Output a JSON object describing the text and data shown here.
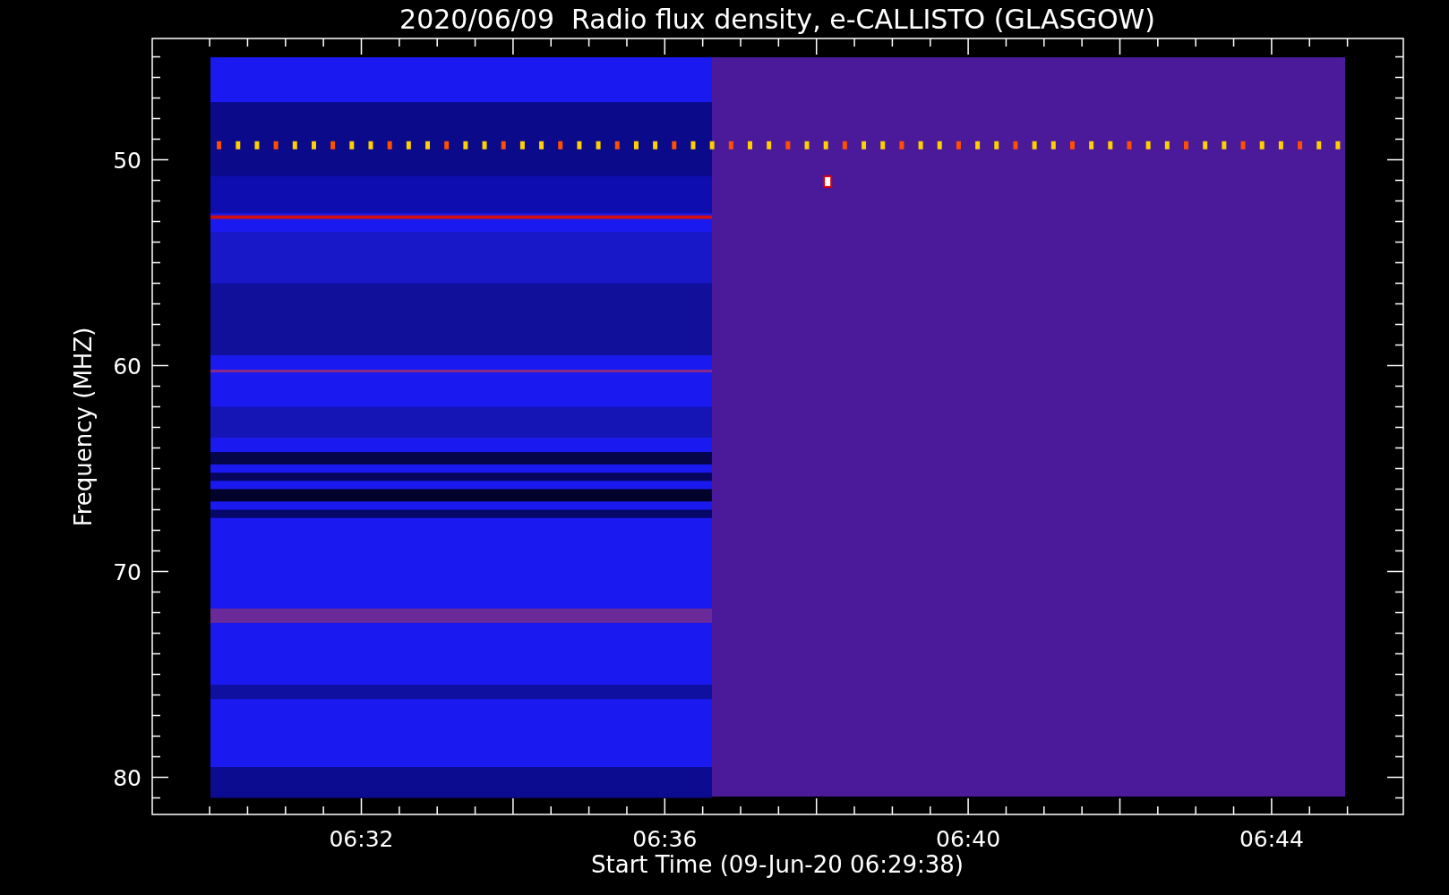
{
  "title": "2020/06/09  Radio flux density, e-CALLISTO (GLASGOW)",
  "x_axis": {
    "label": "Start Time (09-Jun-20 06:29:38)",
    "ticks": [
      "06:32",
      "06:36",
      "06:40",
      "06:44"
    ]
  },
  "y_axis": {
    "label": "Frequency (MHZ)",
    "ticks": [
      "50",
      "60",
      "70",
      "80"
    ]
  }
}
